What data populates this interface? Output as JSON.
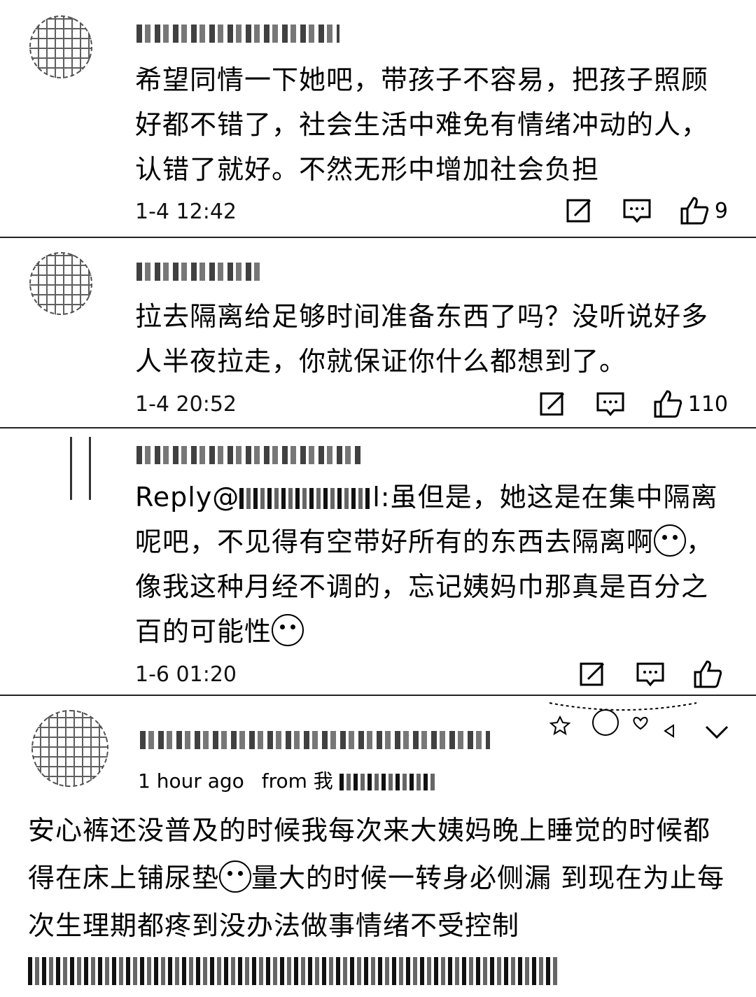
{
  "comments": [
    {
      "text": "希望同情一下她吧，带孩子不容易，把孩子照顾好都不错了，社会生活中难免有情绪冲动的人，认错了就好。不然无形中增加社会负担",
      "time": "1-4 12:42",
      "likes": "9"
    },
    {
      "text": "拉去隔离给足够时间准备东西了吗？没听说好多人半夜拉走，你就保证你什么都想到了。",
      "time": "1-4 20:52",
      "likes": "110"
    },
    {
      "reply_prefix": "Reply@",
      "reply_suffix": "l:虽但是，她这是在集中隔离呢吧，不见得有空带好所有的东西去隔离啊",
      "text_part2": "，像我这种月经不调的，忘记姨妈巾那真是百分之百的可能性",
      "time": "1-6 01:20",
      "likes": ""
    }
  ],
  "post": {
    "time_ago": "1 hour ago",
    "from_label": "from 我",
    "text_part1": "安心裤还没普及的时候我每次来大姨妈晚上睡觉的时候都得在床上铺尿垫",
    "text_part2": "量大的时候一转身必侧漏 到现在为止每次生理期都疼到没办法做事情绪不受控制"
  }
}
